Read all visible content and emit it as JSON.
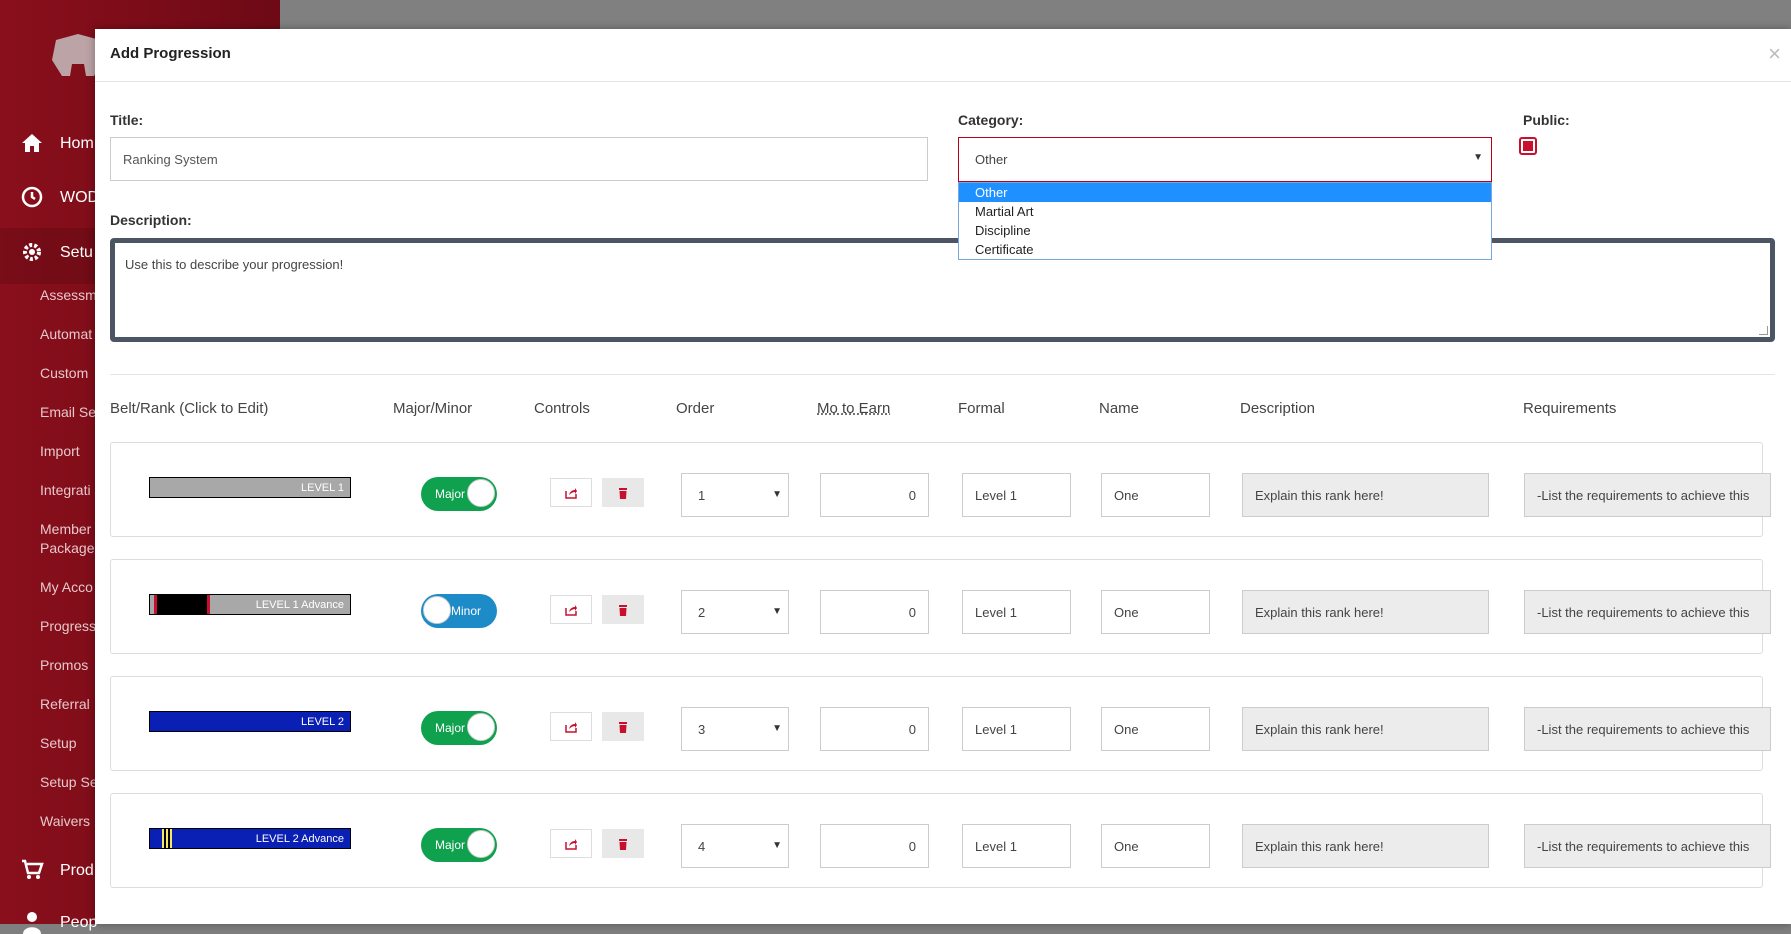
{
  "background": {
    "sidebar_items": [
      {
        "label": "Hom",
        "icon": "home-icon"
      },
      {
        "label": "WOD",
        "icon": "clock-icon"
      },
      {
        "label": "Setu",
        "icon": "gear-icon"
      }
    ],
    "sub_items": [
      "Assessm",
      "Automat",
      "Custom",
      "Email Se",
      "Import",
      "Integrati",
      "Member",
      "Package",
      "My Acco",
      "Progress",
      "Promos",
      "Referral",
      "Setup",
      "Setup Se",
      "Waivers"
    ],
    "bottom_items": [
      {
        "label": "Prod",
        "icon": "cart-icon"
      },
      {
        "label": "Peop",
        "icon": "person-icon"
      }
    ]
  },
  "modal": {
    "title": "Add Progression",
    "close": "×"
  },
  "form": {
    "title_label": "Title:",
    "title_value": "Ranking System",
    "category_label": "Category:",
    "category_value": "Other",
    "category_options": [
      "Other",
      "Martial Art",
      "Discipline",
      "Certificate"
    ],
    "public_label": "Public:",
    "description_label": "Description:",
    "description_value": "Use this to describe your progression!"
  },
  "table": {
    "headers": {
      "belt": "Belt/Rank (Click to Edit)",
      "major": "Major/Minor",
      "controls": "Controls",
      "order": "Order",
      "mo": "Mo to Earn",
      "formal": "Formal",
      "name": "Name",
      "description": "Description",
      "requirements": "Requirements"
    },
    "rows": [
      {
        "belt": "LEVEL 1",
        "type": "Major",
        "order": "1",
        "mo": "0",
        "formal": "Level 1",
        "name": "One",
        "description": "Explain this rank here!",
        "requirements": "-List the requirements to achieve this"
      },
      {
        "belt": "LEVEL 1 Advance",
        "type": "Minor",
        "order": "2",
        "mo": "0",
        "formal": "Level 1",
        "name": "One",
        "description": "Explain this rank here!",
        "requirements": "-List the requirements to achieve this"
      },
      {
        "belt": "LEVEL 2",
        "type": "Major",
        "order": "3",
        "mo": "0",
        "formal": "Level 1",
        "name": "One",
        "description": "Explain this rank here!",
        "requirements": "-List the requirements to achieve this"
      },
      {
        "belt": "LEVEL 2 Advance",
        "type": "Major",
        "order": "4",
        "mo": "0",
        "formal": "Level 1",
        "name": "One",
        "description": "Explain this rank here!",
        "requirements": "-List the requirements to achieve this"
      }
    ]
  },
  "colors": {
    "brand_red": "#c8102e",
    "major_green": "#0fa14e",
    "minor_blue": "#1d8bc7",
    "belt_gray": "#a8a8a8",
    "belt_blue": "#0a1fb3",
    "dropdown_highlight": "#1e90ff"
  }
}
